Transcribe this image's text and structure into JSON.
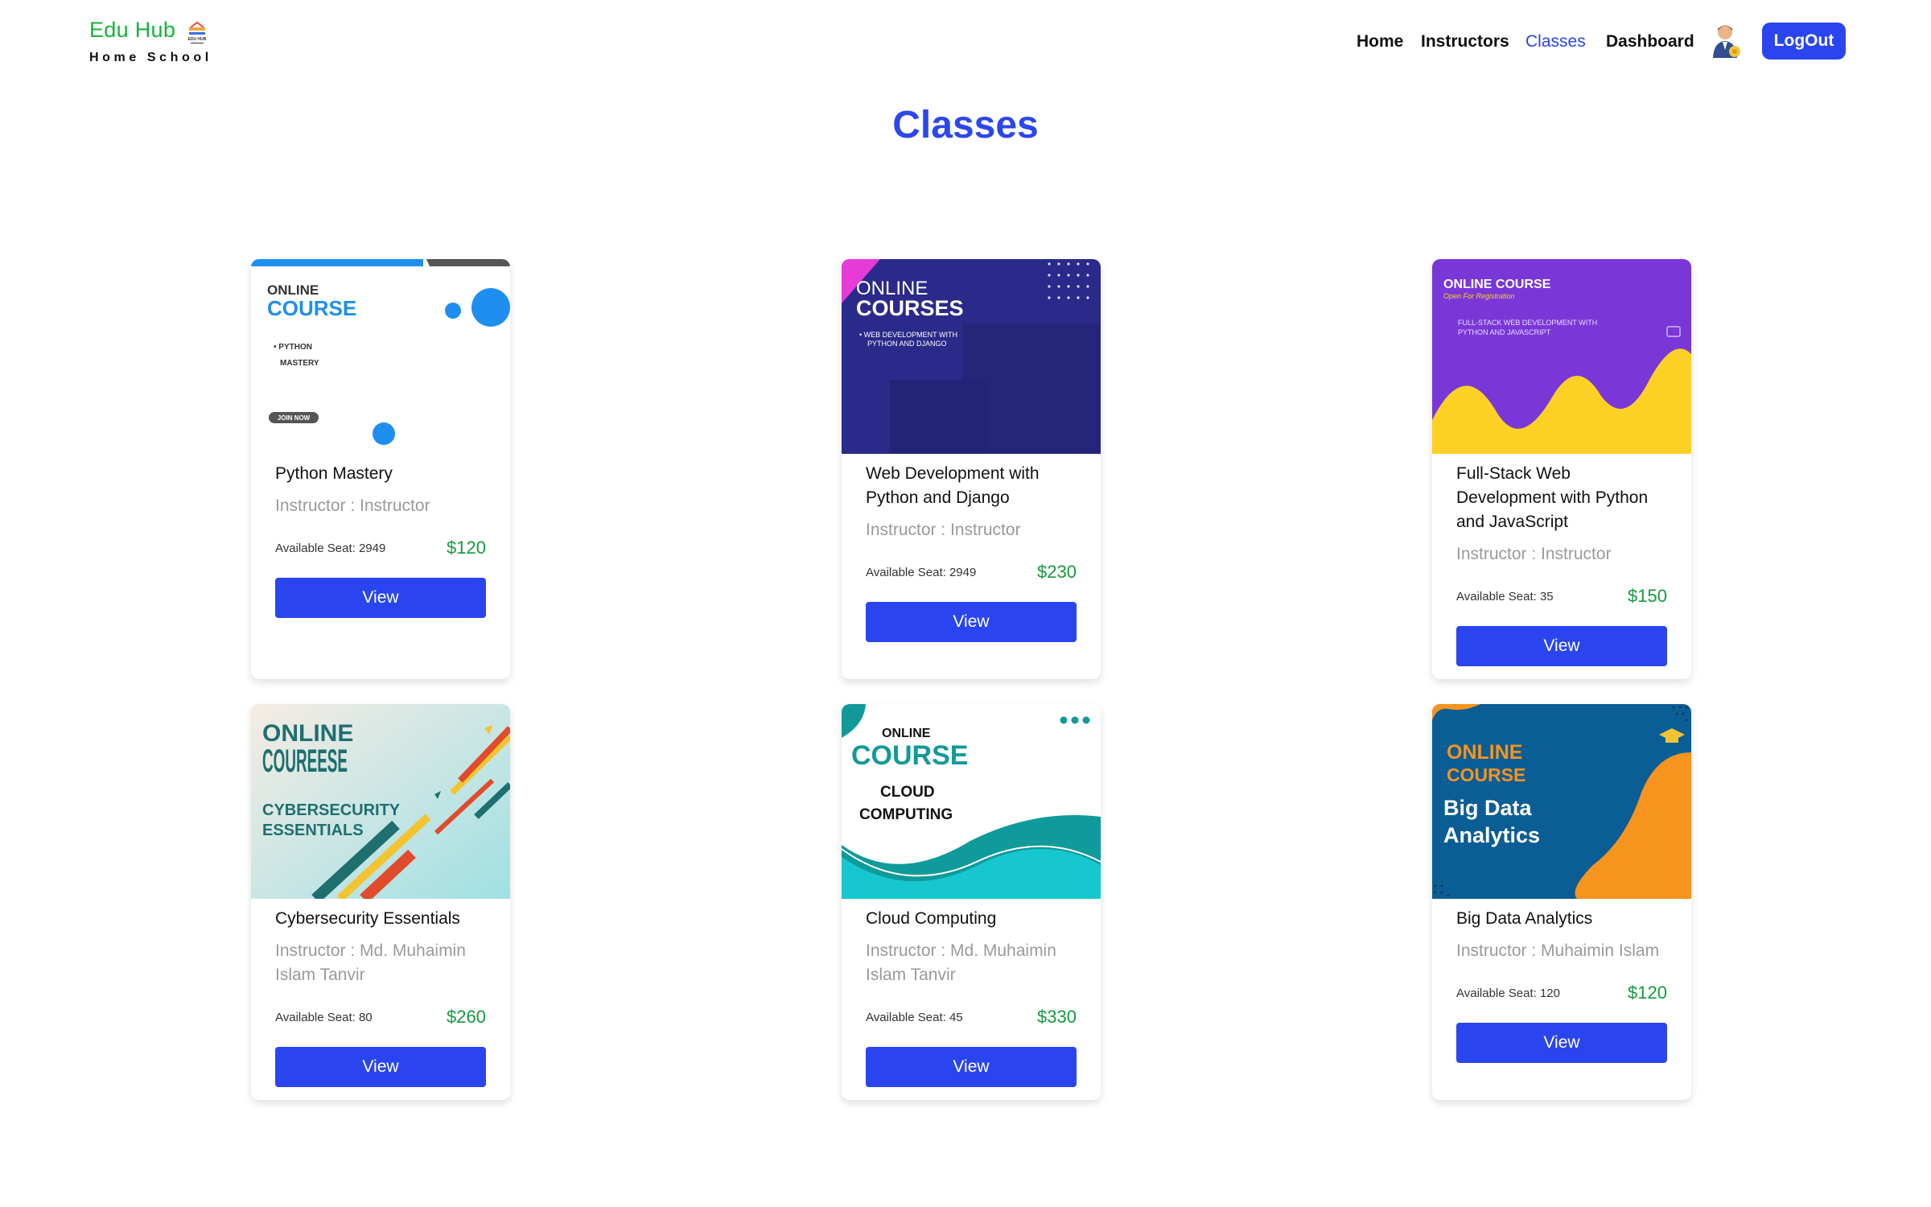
{
  "brand": {
    "name": "Edu Hub",
    "tagline": "Home School",
    "logo_text": "EDU HUB"
  },
  "nav": {
    "items": [
      {
        "label": "Home",
        "active": false
      },
      {
        "label": "Instructors",
        "active": false
      },
      {
        "label": "Classes",
        "active": true
      },
      {
        "label": "Dashboard",
        "active": false
      }
    ],
    "logout_label": "LogOut"
  },
  "page_title": "Classes",
  "seat_prefix": "Available Seat: ",
  "view_label": "View",
  "colors": {
    "accent": "#2a45f0",
    "brand_green": "#16b33b",
    "price_green": "#159a3e"
  },
  "classes": [
    {
      "title": "Python Mastery",
      "instructor": "Instructor : Instructor",
      "seats": "Available Seat: 2949",
      "price": "$120",
      "banner": {
        "line1": "ONLINE",
        "line2": "COURSE",
        "bullet": "• PYTHON",
        "bullet2": "MASTERY",
        "cta": "JOIN NOW"
      }
    },
    {
      "title": "Web Development with Python and Django",
      "instructor": "Instructor : Instructor",
      "seats": "Available Seat: 2949",
      "price": "$230",
      "banner": {
        "line1": "ONLINE",
        "line2": "COURSES",
        "bullet": "• WEB DEVELOPMENT WITH",
        "bullet2": "PYTHON AND DJANGO"
      }
    },
    {
      "title": "Full-Stack Web Development with Python and JavaScript",
      "instructor": "Instructor : Instructor",
      "seats": "Available Seat: 35",
      "price": "$150",
      "banner": {
        "line1": "ONLINE COURSE",
        "line2": "Open For Registration",
        "bullet": "FULL-STACK WEB DEVELOPMENT WITH",
        "bullet2": "PYTHON AND JAVASCRIPT"
      }
    },
    {
      "title": "Cybersecurity Essentials",
      "instructor": "Instructor : Md. Muhaimin Islam Tanvir",
      "seats": "Available Seat: 80",
      "price": "$260",
      "banner": {
        "line1": "ONLINE",
        "line2": "COUREESE",
        "bullet": "CYBERSECURITY",
        "bullet2": "ESSENTIALS"
      }
    },
    {
      "title": "Cloud Computing",
      "instructor": "Instructor : Md. Muhaimin Islam Tanvir",
      "seats": "Available Seat: 45",
      "price": "$330",
      "banner": {
        "line1": "ONLINE",
        "line2": "COURSE",
        "bullet": "CLOUD",
        "bullet2": "COMPUTING"
      }
    },
    {
      "title": "Big Data Analytics",
      "instructor": "Instructor : Muhaimin Islam",
      "seats": "Available Seat: 120",
      "price": "$120",
      "banner": {
        "line1": "ONLINE",
        "line2": "COURSE",
        "bullet": "Big Data",
        "bullet2": "Analytics"
      }
    }
  ]
}
